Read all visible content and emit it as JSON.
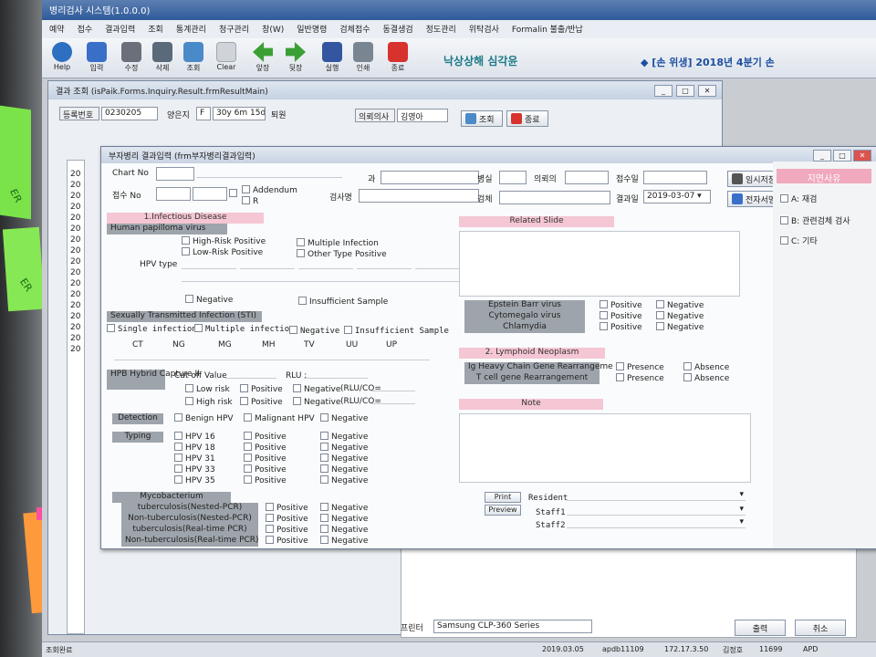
{
  "app": {
    "title": "병리검사 시스템(1.0.0.0)",
    "menu": [
      "예약",
      "접수",
      "결과입력",
      "조회",
      "통계관리",
      "청구관리",
      "창(W)",
      "일반명령",
      "검체접수",
      "동결생검",
      "정도관리",
      "위탁검사",
      "Formalin 불출/반납"
    ],
    "toolbar": [
      {
        "label": "Help",
        "icon": "help-icon",
        "color": "#2d6fc0"
      },
      {
        "label": "입력",
        "icon": "input-icon",
        "color": "#3a6fc8"
      },
      {
        "label": "수정",
        "icon": "tools-icon",
        "color": "#6a6f79"
      },
      {
        "label": "삭제",
        "icon": "trash-icon",
        "color": "#5a6a7a"
      },
      {
        "label": "조회",
        "icon": "search-icon",
        "color": "#4a8ac8"
      },
      {
        "label": "Clear",
        "icon": "clear-icon",
        "color": "#d0d4da"
      },
      {
        "label": "앞장",
        "icon": "arrow-left-icon",
        "color": "#3aa034"
      },
      {
        "label": "뒷장",
        "icon": "arrow-right-icon",
        "color": "#3aa034"
      },
      {
        "label": "실행",
        "icon": "run-icon",
        "color": "#3456a0"
      },
      {
        "label": "인쇄",
        "icon": "printer-icon",
        "color": "#7a8592"
      },
      {
        "label": "종료",
        "icon": "power-icon",
        "color": "#d8322e"
      }
    ],
    "header_name": "낙상상해 심각윤",
    "quarter_notice": "◆ [손 위생] 2018년 4분기 손"
  },
  "sticky_notes": [
    "ER",
    "ER"
  ],
  "result_window": {
    "title": "결과 조회 (isPaik.Forms.Inquiry.Result.frmResultMain)",
    "reg_label": "등록번호",
    "reg_no": "0230205",
    "name": "양은지",
    "sex": "F",
    "age": "30y 6m 15d",
    "status": "퇴원",
    "doctor_label": "의뢰의사",
    "doctor": "김영아",
    "search_button": "조회",
    "close_button": "종료",
    "row_labels": [
      "20",
      "20",
      "20",
      "20",
      "20",
      "20",
      "20",
      "20",
      "20",
      "20",
      "20",
      "20",
      "20",
      "20",
      "20",
      "20",
      "20"
    ],
    "printer_label": "프린터",
    "printer": "Samsung CLP-360 Series",
    "output_button": "출력",
    "cancel_button": "취소"
  },
  "dialog": {
    "title": "부자병리 결과입력    (frm부자병리결과입력)",
    "chart_no_label": "Chart No",
    "receipt_no_label": "접수 No",
    "addendum_label": "Addendum",
    "r_label": "R",
    "dept_label": "과",
    "ward_label": "병실",
    "requester_label": "의뢰의",
    "receipt_date_label": "접수일",
    "examiner_label": "검사명",
    "specimen_label": "검체",
    "result_date_label": "결과일",
    "result_date": "2019-03-07",
    "temp_save_button": "임시저장",
    "esign_button": "전자서명",
    "infectious": {
      "title": "1.Infectious Disease",
      "hpv_title": "Human papilloma virus",
      "high_risk": "High-Risk Positive",
      "low_risk": "Low-Risk Positive",
      "multiple": "Multiple Infection",
      "other_type": "Other Type Positive",
      "hpv_type_label": "HPV type",
      "negative": "Negative",
      "insufficient": "Insufficient Sample"
    },
    "sti": {
      "title": "Sexually Transmitted Infection (STI)",
      "options": [
        "Single infection",
        "Multiple infection",
        "Negative",
        "Insufficient Sample"
      ],
      "codes": [
        "CT",
        "NG",
        "MG",
        "MH",
        "TV",
        "UU",
        "UP"
      ]
    },
    "hpb": {
      "title": "HPB Hybrid Capture II",
      "cutoff_label": "Cut off Value",
      "rlu_label": "RLU :",
      "rows": [
        {
          "risk": "Low risk",
          "pos": "Positive",
          "neg": "Negative",
          "ratio": "(RLU/CO="
        },
        {
          "risk": "High risk",
          "pos": "Positive",
          "neg": "Negative",
          "ratio": "(RLU/CO="
        }
      ]
    },
    "detection": {
      "title": "Detection",
      "options": [
        "Benign HPV",
        "Malignant HPV",
        "Negative"
      ]
    },
    "typing": {
      "title": "Typing",
      "types": [
        "HPV 16",
        "HPV 18",
        "HPV 31",
        "HPV 33",
        "HPV 35"
      ],
      "pos": "Positive",
      "neg": "Negative"
    },
    "mycobacterium": {
      "title": "Mycobacterium",
      "rows": [
        "tuberculosis(Nested-PCR)",
        "Non-tuberculosis(Nested-PCR)",
        "tuberculosis(Real-time PCR)",
        "Non-tuberculosis(Real-time PCR)"
      ],
      "pos": "Positive",
      "neg": "Negative"
    },
    "related_slide": "Related Slide",
    "viruses": {
      "rows": [
        "Epstein Barr virus",
        "Cytomegalo virus",
        "Chlamydia"
      ],
      "pos": "Positive",
      "neg": "Negative"
    },
    "lymphoid": {
      "title": "2. Lymphoid Neoplasm",
      "rows": [
        "Ig Heavy Chain Gene Rearrangeme",
        "T cell gene Rearrangement"
      ],
      "presence": "Presence",
      "absence": "Absence"
    },
    "note": "Note",
    "print_button": "Print",
    "preview_button": "Preview",
    "resident_label": "Resident",
    "staff1_label": "Staff1",
    "staff2_label": "Staff2",
    "delay": {
      "title": "지연사유",
      "options": [
        "A: 재검",
        "B: 관련검체 검사",
        "C: 기타"
      ]
    }
  },
  "statusbar": {
    "left": "조회완료",
    "date": "2019.03.05",
    "user": "apdb11109",
    "ip": "172.17.3.50",
    "staff": "김정호",
    "code": "11699",
    "mode": "APD"
  },
  "colors": {
    "pink": "#f5c6d4",
    "accent_pink": "#f0a9bd",
    "title_blue": "#2f5a9a"
  }
}
